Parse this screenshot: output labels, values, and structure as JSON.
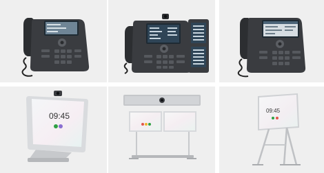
{
  "products": [
    {
      "id": "desk-phone",
      "icon": "ip-desk-phone"
    },
    {
      "id": "video-desk-phone-with-key-modules",
      "icon": "video-desk-phone"
    },
    {
      "id": "desk-phone-color",
      "icon": "ip-desk-phone"
    },
    {
      "id": "desktop-video-device",
      "icon": "video-desk-device",
      "screen_time": "09:45"
    },
    {
      "id": "room-video-bar",
      "icon": "room-video-system"
    },
    {
      "id": "board-on-stand",
      "icon": "video-board",
      "screen_time": "09:45"
    }
  ],
  "colors": {
    "tile_background": "#efefef",
    "phone_body": "#3a3c40",
    "screen_dark": "#1e2a33",
    "screen_lit": "#eef2f5",
    "stand": "#c7c9cc"
  }
}
